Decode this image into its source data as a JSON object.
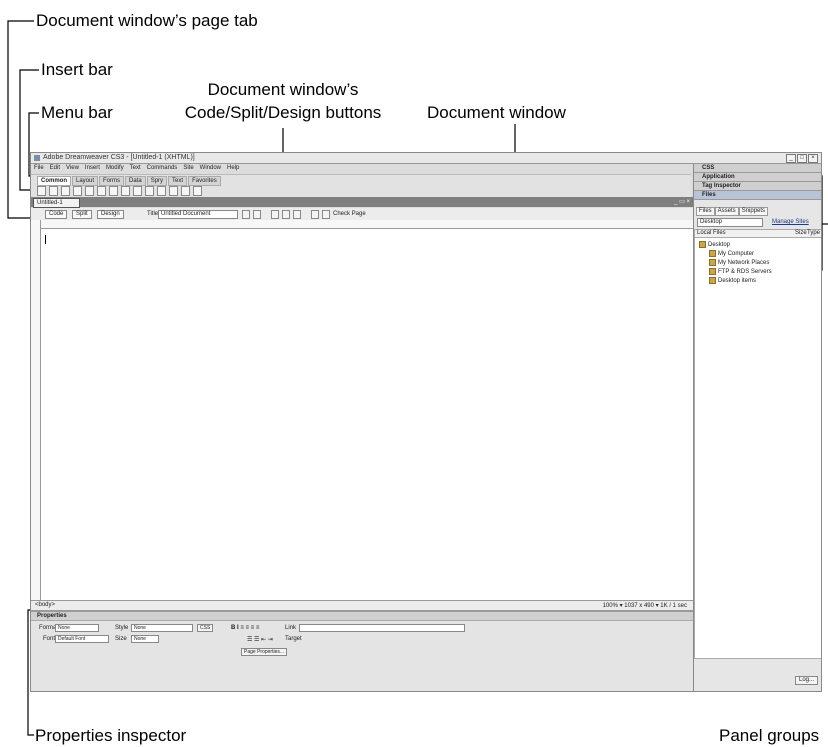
{
  "callouts": {
    "page_tab": "Document window’s page tab",
    "insert_bar": "Insert bar",
    "menu_bar": "Menu bar",
    "code_split_design_l1": "Document window’s",
    "code_split_design_l2": "Code/Split/Design buttons",
    "document_window": "Document window",
    "properties_inspector": "Properties inspector",
    "panel_groups": "Panel groups"
  },
  "app": {
    "window_title": "Adobe Dreamweaver CS3 - [Untitled-1 (XHTML)]",
    "menu_items": [
      "File",
      "Edit",
      "View",
      "Insert",
      "Modify",
      "Text",
      "Commands",
      "Site",
      "Window",
      "Help"
    ],
    "insert_tabs": [
      "Common",
      "Layout",
      "Forms",
      "Data",
      "Spry",
      "Text",
      "Favorites"
    ],
    "insert_active_tab": "Common",
    "page_tab_label": "Untitled-1",
    "view_buttons": {
      "code": "Code",
      "split": "Split",
      "design": "Design"
    },
    "title_label": "Title:",
    "title_value": "Untitled Document",
    "check_page": "Check Page",
    "tag_selector": "<body>",
    "status_info": "100%   ▾  1037 x 490 ▾  1K / 1 sec",
    "properties": {
      "title": "Properties",
      "format_label": "Format",
      "format_value": "None",
      "style_label": "Style",
      "style_value": "None",
      "css_button": "CSS",
      "font_label": "Font",
      "font_value": "Default Font",
      "size_label": "Size",
      "size_value": "None",
      "link_label": "Link",
      "target_label": "Target",
      "page_properties": "Page Properties..."
    },
    "panels": {
      "groups": [
        "CSS",
        "Application",
        "Tag Inspector",
        "Files"
      ],
      "files_tabs": [
        "Files",
        "Assets",
        "Snippets"
      ],
      "site_select": "Desktop",
      "manage_sites": "Manage Sites",
      "tree_header": {
        "local": "Local Files",
        "size": "Size",
        "type": "Type"
      },
      "tree_items": [
        "Desktop",
        "My Computer",
        "My Network Places",
        "FTP & RDS Servers",
        "Desktop items"
      ],
      "log_button": "Log..."
    }
  }
}
